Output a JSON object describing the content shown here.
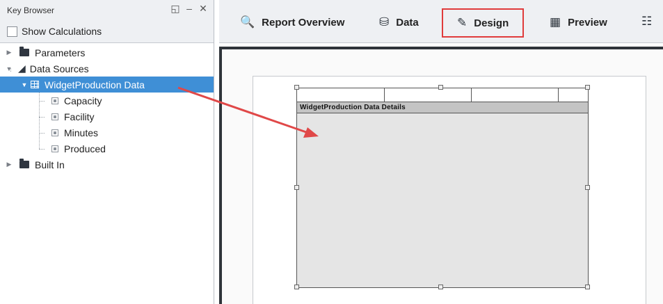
{
  "key_browser": {
    "title": "Key Browser",
    "show_calculations_label": "Show Calculations",
    "show_calculations_checked": false,
    "tree": {
      "parameters": "Parameters",
      "data_sources": "Data Sources",
      "widget_data": "WidgetProduction Data",
      "fields": [
        "Capacity",
        "Facility",
        "Minutes",
        "Produced"
      ],
      "built_in": "Built In"
    }
  },
  "toolbar": {
    "report_overview": "Report Overview",
    "data": "Data",
    "design": "Design",
    "preview": "Preview",
    "active_tab": "Design"
  },
  "canvas": {
    "details_band_label": "WidgetProduction Data Details"
  },
  "colors": {
    "selection": "#3f8fd6",
    "highlight_border": "#e03b3b",
    "arrow": "#e04848"
  },
  "icons": {
    "restore": "restore-icon",
    "minimize": "minimize-icon",
    "close": "close-icon",
    "report_overview": "magnifier-doc-icon",
    "data": "database-icon",
    "design": "edit-icon",
    "preview": "image-icon",
    "calendar": "calendar-icon"
  }
}
